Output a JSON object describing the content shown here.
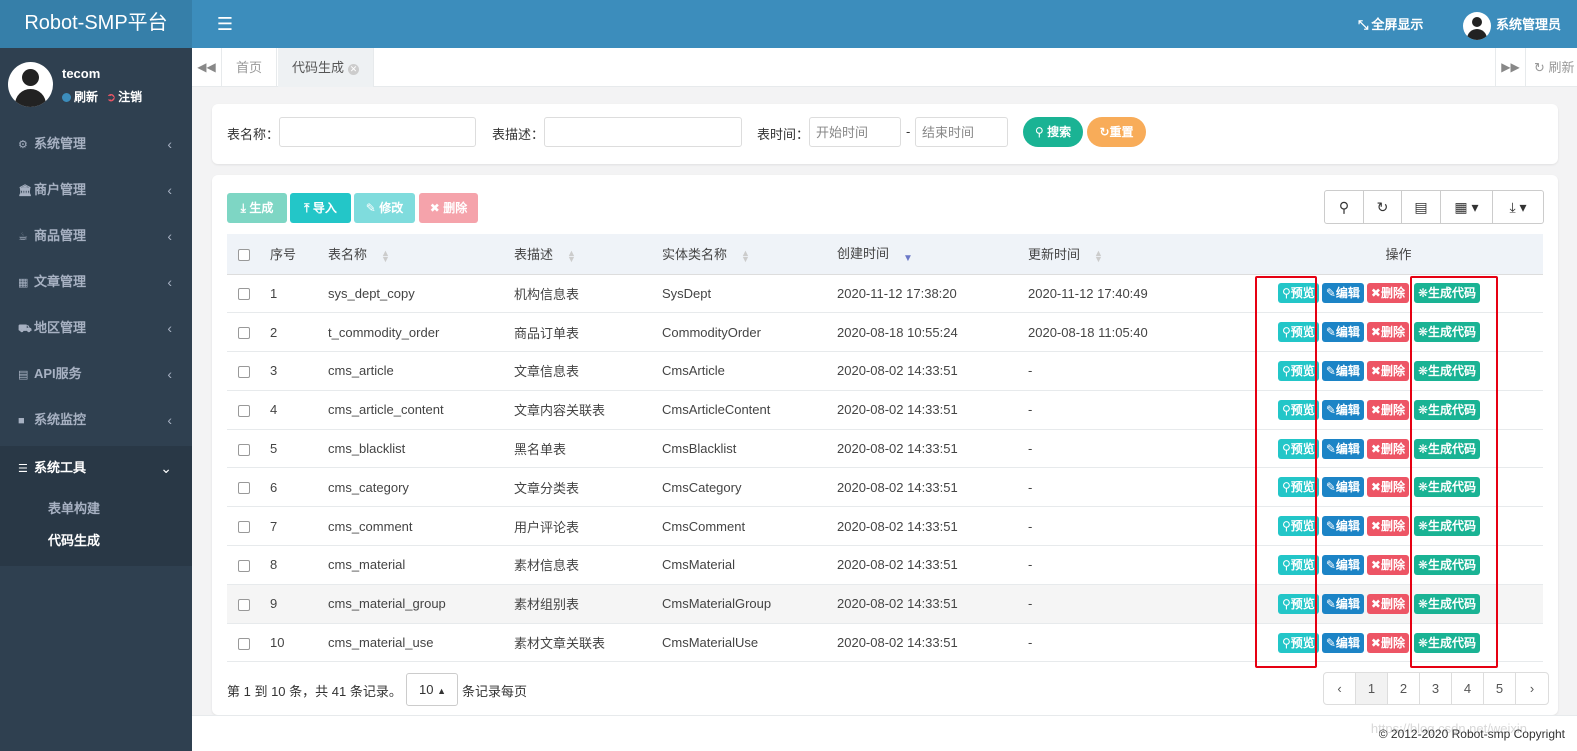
{
  "app": {
    "brand": "Robot-SMP平台"
  },
  "header": {
    "fullscreen_label": "全屏显示",
    "user_label": "系统管理员"
  },
  "sidebar": {
    "username": "tecom",
    "refresh_label": "刷新",
    "logout_label": "注销",
    "items": [
      {
        "label": "系统管理",
        "icon": "gear-icon"
      },
      {
        "label": "商户管理",
        "icon": "bank-icon"
      },
      {
        "label": "商品管理",
        "icon": "coffee-icon"
      },
      {
        "label": "文章管理",
        "icon": "calendar-icon"
      },
      {
        "label": "地区管理",
        "icon": "car-icon"
      },
      {
        "label": "API服务",
        "icon": "id-card-icon"
      },
      {
        "label": "系统监控",
        "icon": "video-camera-icon"
      },
      {
        "label": "系统工具",
        "icon": "list-icon"
      }
    ],
    "subitems": [
      {
        "label": "表单构建"
      },
      {
        "label": "代码生成"
      }
    ]
  },
  "tabs": {
    "items": [
      {
        "label": "首页"
      },
      {
        "label": "代码生成"
      }
    ],
    "refresh_label": "刷新"
  },
  "search": {
    "table_name_label": "表名称：",
    "table_desc_label": "表描述：",
    "time_label": "表时间：",
    "start_placeholder": "开始时间",
    "end_placeholder": "结束时间",
    "dash": "-",
    "search_button": "搜索",
    "reset_button": "重置"
  },
  "toolbar": {
    "generate": "生成",
    "import": "导入",
    "modify": "修改",
    "delete": "删除"
  },
  "table": {
    "headers": [
      "序号",
      "表名称",
      "表描述",
      "实体类名称",
      "创建时间",
      "更新时间",
      "操作"
    ],
    "action_labels": {
      "preview": "预览",
      "edit": "编辑",
      "delete": "删除",
      "generate": "生成代码"
    },
    "rows": [
      [
        "1",
        "sys_dept_copy",
        "机构信息表",
        "SysDept",
        "2020-11-12 17:38:20",
        "2020-11-12 17:40:49"
      ],
      [
        "2",
        "t_commodity_order",
        "商品订单表",
        "CommodityOrder",
        "2020-08-18 10:55:24",
        "2020-08-18 11:05:40"
      ],
      [
        "3",
        "cms_article",
        "文章信息表",
        "CmsArticle",
        "2020-08-02 14:33:51",
        "-"
      ],
      [
        "4",
        "cms_article_content",
        "文章内容关联表",
        "CmsArticleContent",
        "2020-08-02 14:33:51",
        "-"
      ],
      [
        "5",
        "cms_blacklist",
        "黑名单表",
        "CmsBlacklist",
        "2020-08-02 14:33:51",
        "-"
      ],
      [
        "6",
        "cms_category",
        "文章分类表",
        "CmsCategory",
        "2020-08-02 14:33:51",
        "-"
      ],
      [
        "7",
        "cms_comment",
        "用户评论表",
        "CmsComment",
        "2020-08-02 14:33:51",
        "-"
      ],
      [
        "8",
        "cms_material",
        "素材信息表",
        "CmsMaterial",
        "2020-08-02 14:33:51",
        "-"
      ],
      [
        "9",
        "cms_material_group",
        "素材组别表",
        "CmsMaterialGroup",
        "2020-08-02 14:33:51",
        "-"
      ],
      [
        "10",
        "cms_material_use",
        "素材文章关联表",
        "CmsMaterialUse",
        "2020-08-02 14:33:51",
        "-"
      ]
    ]
  },
  "pagination": {
    "info": "第 1 到 10 条，共 41 条记录。",
    "page_size": "10",
    "suffix": "条记录每页",
    "prev": "‹",
    "next": "›",
    "pages": [
      "1",
      "2",
      "3",
      "4",
      "5"
    ],
    "current": "1"
  },
  "footer": {
    "copyright": "© 2012-2020 Robot-smp Copyright",
    "watermark": "https://blog.csdn.net/weixin"
  },
  "colors": {
    "header": "#3c8dbc",
    "sidebar": "#2f4050",
    "primary": "#1ab394",
    "info": "#23c6c8",
    "success": "#1c84c6",
    "danger": "#ed5565",
    "warning": "#f8ac59",
    "annotation": "#e60012"
  }
}
